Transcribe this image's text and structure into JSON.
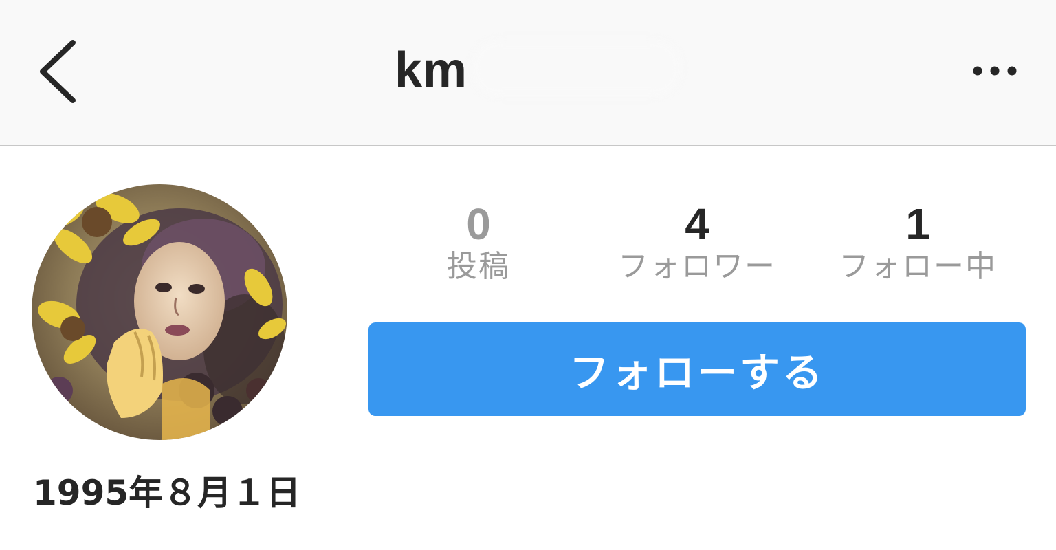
{
  "header": {
    "username_visible": "km",
    "back_icon": "chevron-left-icon",
    "more_icon": "more-horizontal-icon"
  },
  "profile": {
    "avatar_alt": "profile-avatar",
    "stats": [
      {
        "value": "0",
        "label": "投稿"
      },
      {
        "value": "4",
        "label": "フォロワー"
      },
      {
        "value": "1",
        "label": "フォロー中"
      }
    ],
    "follow_button_label": "フォローする",
    "bio": "1995年８月１日"
  },
  "colors": {
    "accent": "#3897f0",
    "header_bg": "#f9f9f9",
    "text": "#262626",
    "muted": "#9a9a9a"
  }
}
